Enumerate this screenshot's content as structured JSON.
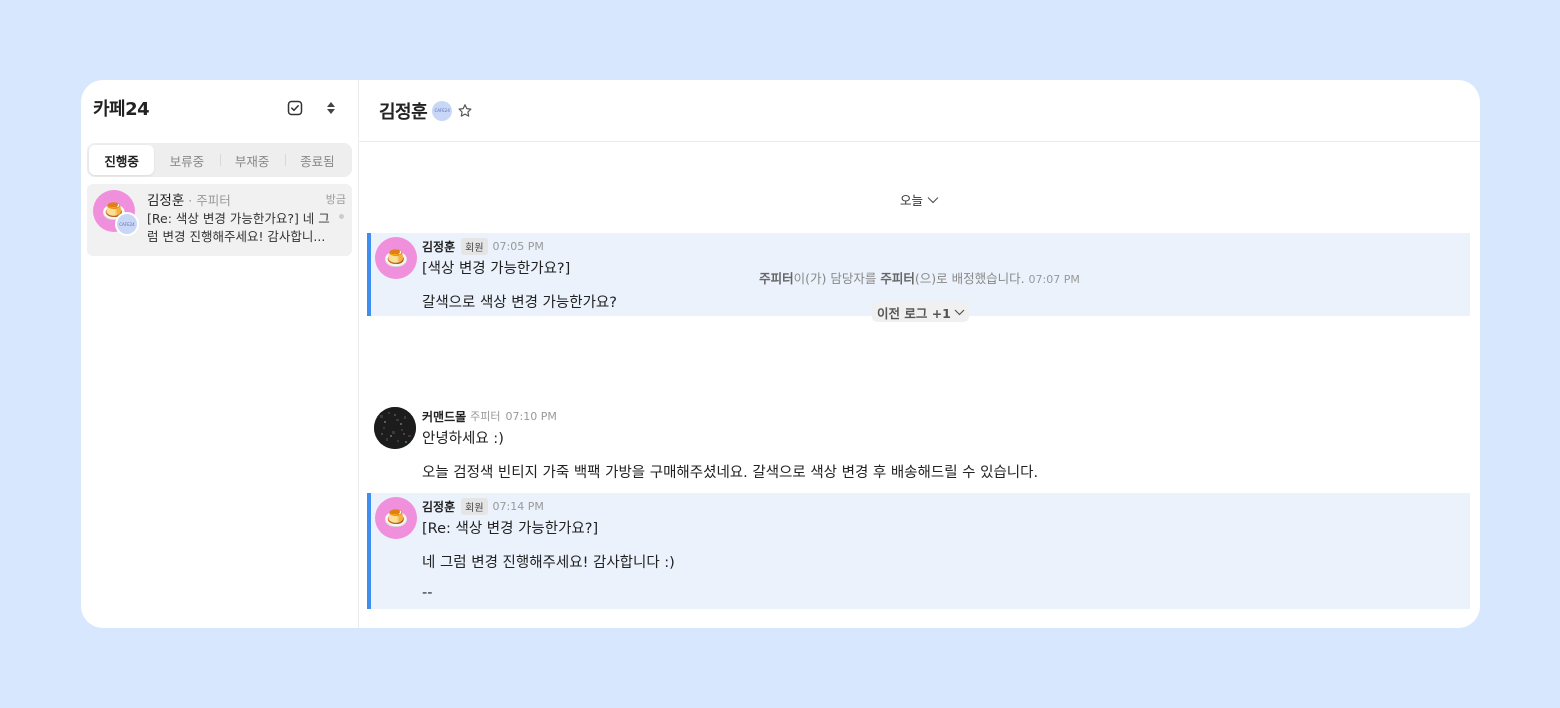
{
  "sidebar": {
    "title": "카페24",
    "tabs": [
      {
        "label": "진행중",
        "active": true
      },
      {
        "label": "보류중",
        "active": false
      },
      {
        "label": "부재중",
        "active": false
      },
      {
        "label": "종료됨",
        "active": false
      }
    ],
    "conversations": [
      {
        "name": "김정훈",
        "assignee": "· 주피터",
        "time": "방금",
        "preview": "[Re: 색상 변경 가능한가요?] 네 그럼 변경 진행해주세요! 감사합니...",
        "avatar_icon": "pudding-icon",
        "badge_text": "CAFE24"
      }
    ]
  },
  "main": {
    "title": "김정훈",
    "badge_text": "CAFE24",
    "date_divider": "오늘",
    "messages": [
      {
        "sender": "김정훈",
        "role": "회원",
        "time": "07:05 PM",
        "lines": [
          "[색상 변경 가능한가요?]",
          "갈색으로 색상 변경 가능한가요?"
        ]
      },
      {
        "sender": "커맨드몰",
        "role": "주피터",
        "time": "07:10 PM",
        "lines": [
          "안녕하세요 :)",
          "오늘 검정색 빈티지 가죽 백팩 가방을 구매해주셨네요. 갈색으로 색상 변경 후 배송해드릴 수 있습니다."
        ]
      },
      {
        "sender": "김정훈",
        "role": "회원",
        "time": "07:14 PM",
        "lines": [
          "[Re: 색상 변경 가능한가요?]",
          "네 그럼 변경 진행해주세요! 감사합니다 :)",
          "--"
        ]
      }
    ],
    "system": {
      "actor": "주피터",
      "text1": "이(가) 담당자를 ",
      "target": "주피터",
      "text2": "(으)로 배정했습니다.",
      "time": "07:07 PM"
    },
    "log_pill": "이전 로그 +1"
  },
  "colors": {
    "background": "#d7e7fd",
    "accent": "#3d8ef0",
    "customer_bubble": "#ebf2fc",
    "avatar_pink": "#f08fdb"
  }
}
